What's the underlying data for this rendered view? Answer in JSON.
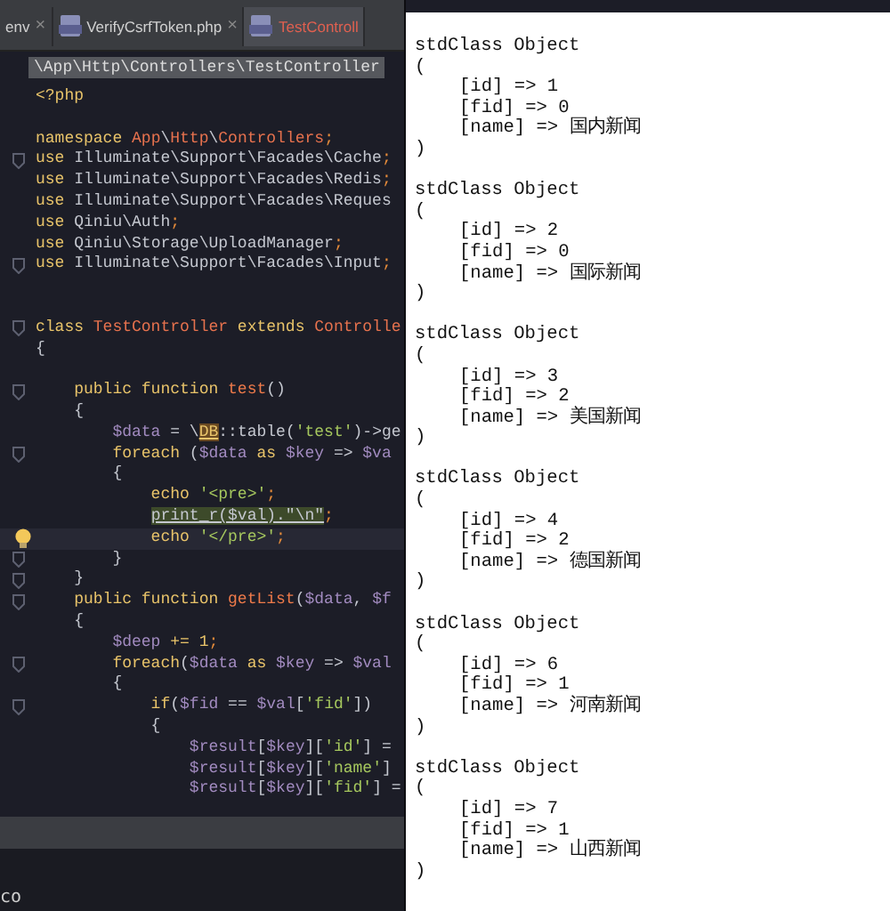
{
  "editor": {
    "tabs": [
      {
        "label": "env",
        "close": "×",
        "selected": false
      },
      {
        "label": "VerifyCsrfToken.php",
        "close": "×",
        "selected": false
      },
      {
        "label": "TestControll",
        "selected": true
      }
    ],
    "breadcrumb": "\\App\\Http\\Controllers\\TestController",
    "lines": [
      {
        "fold": false,
        "current": false,
        "segs": [
          {
            "kind": "kw",
            "text": "<?php"
          }
        ]
      },
      {
        "fold": false,
        "current": false
      },
      {
        "fold": false,
        "current": false,
        "segs": [
          {
            "kind": "kw",
            "text": "namespace "
          },
          {
            "kind": "cls",
            "text": "App"
          },
          {
            "kind": "plain",
            "text": "\\"
          },
          {
            "kind": "cls",
            "text": "Http"
          },
          {
            "kind": "plain",
            "text": "\\"
          },
          {
            "kind": "cls",
            "text": "Controllers"
          },
          {
            "kind": "punct",
            "text": ";"
          }
        ]
      },
      {
        "fold": true,
        "current": false,
        "segs": [
          {
            "kind": "kw",
            "text": "use "
          },
          {
            "kind": "plain",
            "text": "Illuminate\\Support\\Facades\\Cache"
          },
          {
            "kind": "punct",
            "text": ";"
          }
        ]
      },
      {
        "fold": false,
        "current": false,
        "segs": [
          {
            "kind": "kw",
            "text": "use "
          },
          {
            "kind": "plain",
            "text": "Illuminate\\Support\\Facades\\Redis"
          },
          {
            "kind": "punct",
            "text": ";"
          }
        ]
      },
      {
        "fold": false,
        "current": false,
        "segs": [
          {
            "kind": "kw",
            "text": "use "
          },
          {
            "kind": "plain",
            "text": "Illuminate\\Support\\Facades\\Reques"
          }
        ]
      },
      {
        "fold": false,
        "current": false,
        "segs": [
          {
            "kind": "kw",
            "text": "use "
          },
          {
            "kind": "plain",
            "text": "Qiniu\\Auth"
          },
          {
            "kind": "punct",
            "text": ";"
          }
        ]
      },
      {
        "fold": false,
        "current": false,
        "segs": [
          {
            "kind": "kw",
            "text": "use "
          },
          {
            "kind": "plain",
            "text": "Qiniu\\Storage\\UploadManager"
          },
          {
            "kind": "punct",
            "text": ";"
          }
        ]
      },
      {
        "fold": true,
        "current": false,
        "segs": [
          {
            "kind": "kw",
            "text": "use "
          },
          {
            "kind": "plain",
            "text": "Illuminate\\Support\\Facades\\Input"
          },
          {
            "kind": "punct",
            "text": ";"
          }
        ]
      },
      {
        "fold": false,
        "current": false
      },
      {
        "fold": false,
        "current": false
      },
      {
        "fold": true,
        "current": false,
        "segs": [
          {
            "kind": "kw",
            "text": "class "
          },
          {
            "kind": "cls",
            "text": "TestController "
          },
          {
            "kind": "kw",
            "text": "extends "
          },
          {
            "kind": "cls",
            "text": "Controlle"
          }
        ]
      },
      {
        "fold": false,
        "current": false,
        "segs": [
          {
            "kind": "plain",
            "text": "{"
          }
        ]
      },
      {
        "fold": false,
        "current": false
      },
      {
        "fold": true,
        "current": false,
        "segs": [
          {
            "kind": "kw",
            "text": "    public function "
          },
          {
            "kind": "fn",
            "text": "test"
          },
          {
            "kind": "plain",
            "text": "()"
          }
        ]
      },
      {
        "fold": false,
        "current": false,
        "segs": [
          {
            "kind": "plain",
            "text": "    {"
          }
        ]
      },
      {
        "fold": false,
        "current": false,
        "segs": [
          {
            "kind": "var",
            "text": "        $data"
          },
          {
            "kind": "plain",
            "text": " = \\"
          },
          {
            "kind": "ref",
            "text": "DB"
          },
          {
            "kind": "plain",
            "text": "::table("
          },
          {
            "kind": "str",
            "text": "'test'"
          },
          {
            "kind": "plain",
            "text": ")->ge"
          }
        ]
      },
      {
        "fold": true,
        "current": false,
        "segs": [
          {
            "kind": "kw",
            "text": "        foreach "
          },
          {
            "kind": "plain",
            "text": "("
          },
          {
            "kind": "var",
            "text": "$data "
          },
          {
            "kind": "kw",
            "text": "as "
          },
          {
            "kind": "var",
            "text": "$key "
          },
          {
            "kind": "plain",
            "text": "=> "
          },
          {
            "kind": "var",
            "text": "$va"
          }
        ]
      },
      {
        "fold": false,
        "current": false,
        "segs": [
          {
            "kind": "plain",
            "text": "        {"
          }
        ]
      },
      {
        "fold": false,
        "current": false,
        "segs": [
          {
            "kind": "kw",
            "text": "            echo "
          },
          {
            "kind": "str",
            "text": "'<pre>'"
          },
          {
            "kind": "punct",
            "text": ";"
          }
        ]
      },
      {
        "fold": false,
        "current": false,
        "segs": [
          {
            "kind": "marked",
            "text": "            print_r($val).\"\\n\""
          },
          {
            "kind": "punct",
            "text": ";"
          }
        ]
      },
      {
        "fold": false,
        "current": true,
        "segs": [
          {
            "kind": "kw",
            "text": "            echo "
          },
          {
            "kind": "str",
            "text": "'</pre>'"
          },
          {
            "kind": "punct",
            "text": ";"
          }
        ]
      },
      {
        "fold": true,
        "current": false,
        "segs": [
          {
            "kind": "plain",
            "text": "        }"
          }
        ]
      },
      {
        "fold": true,
        "current": false,
        "segs": [
          {
            "kind": "plain",
            "text": "    }"
          }
        ]
      },
      {
        "fold": true,
        "current": false,
        "segs": [
          {
            "kind": "kw",
            "text": "    public function "
          },
          {
            "kind": "fn",
            "text": "getList"
          },
          {
            "kind": "plain",
            "text": "("
          },
          {
            "kind": "var",
            "text": "$data"
          },
          {
            "kind": "plain",
            "text": ", "
          },
          {
            "kind": "var",
            "text": "$f"
          }
        ]
      },
      {
        "fold": false,
        "current": false,
        "segs": [
          {
            "kind": "plain",
            "text": "    {"
          }
        ]
      },
      {
        "fold": false,
        "current": false,
        "segs": [
          {
            "kind": "var",
            "text": "        $deep "
          },
          {
            "kind": "kw",
            "text": "+= 1"
          },
          {
            "kind": "punct",
            "text": ";"
          }
        ]
      },
      {
        "fold": true,
        "current": false,
        "segs": [
          {
            "kind": "kw",
            "text": "        foreach"
          },
          {
            "kind": "plain",
            "text": "("
          },
          {
            "kind": "var",
            "text": "$data "
          },
          {
            "kind": "kw",
            "text": "as "
          },
          {
            "kind": "var",
            "text": "$key "
          },
          {
            "kind": "plain",
            "text": "=> "
          },
          {
            "kind": "var",
            "text": "$val"
          }
        ]
      },
      {
        "fold": false,
        "current": false,
        "segs": [
          {
            "kind": "plain",
            "text": "        {"
          }
        ]
      },
      {
        "fold": true,
        "current": false,
        "segs": [
          {
            "kind": "kw",
            "text": "            if"
          },
          {
            "kind": "plain",
            "text": "("
          },
          {
            "kind": "var",
            "text": "$fid "
          },
          {
            "kind": "plain",
            "text": "== "
          },
          {
            "kind": "var",
            "text": "$val"
          },
          {
            "kind": "plain",
            "text": "["
          },
          {
            "kind": "str",
            "text": "'fid'"
          },
          {
            "kind": "plain",
            "text": "])"
          }
        ]
      },
      {
        "fold": false,
        "current": false,
        "segs": [
          {
            "kind": "plain",
            "text": "            {"
          }
        ]
      },
      {
        "fold": false,
        "current": false,
        "segs": [
          {
            "kind": "var",
            "text": "                $result"
          },
          {
            "kind": "plain",
            "text": "["
          },
          {
            "kind": "var",
            "text": "$key"
          },
          {
            "kind": "plain",
            "text": "]["
          },
          {
            "kind": "str",
            "text": "'id'"
          },
          {
            "kind": "plain",
            "text": "] ="
          }
        ]
      },
      {
        "fold": false,
        "current": false,
        "segs": [
          {
            "kind": "var",
            "text": "                $result"
          },
          {
            "kind": "plain",
            "text": "["
          },
          {
            "kind": "var",
            "text": "$key"
          },
          {
            "kind": "plain",
            "text": "]["
          },
          {
            "kind": "str",
            "text": "'name'"
          },
          {
            "kind": "plain",
            "text": "]"
          }
        ]
      },
      {
        "fold": false,
        "current": false,
        "segs": [
          {
            "kind": "var",
            "text": "                $result"
          },
          {
            "kind": "plain",
            "text": "["
          },
          {
            "kind": "var",
            "text": "$key"
          },
          {
            "kind": "plain",
            "text": "]["
          },
          {
            "kind": "str",
            "text": "'fid'"
          },
          {
            "kind": "plain",
            "text": "] ="
          }
        ]
      }
    ],
    "terminal": "co"
  },
  "output": {
    "objects": [
      {
        "title": "stdClass Object",
        "open": "(",
        "fields": [
          "[id] => 1",
          "[fid] => 0",
          "[name] => 国内新闻"
        ],
        "close": ")"
      },
      {
        "title": "stdClass Object",
        "open": "(",
        "fields": [
          "[id] => 2",
          "[fid] => 0",
          "[name] => 国际新闻"
        ],
        "close": ")"
      },
      {
        "title": "stdClass Object",
        "open": "(",
        "fields": [
          "[id] => 3",
          "[fid] => 2",
          "[name] => 美国新闻"
        ],
        "close": ")"
      },
      {
        "title": "stdClass Object",
        "open": "(",
        "fields": [
          "[id] => 4",
          "[fid] => 2",
          "[name] => 德国新闻"
        ],
        "close": ")"
      },
      {
        "title": "stdClass Object",
        "open": "(",
        "fields": [
          "[id] => 6",
          "[fid] => 1",
          "[name] => 河南新闻"
        ],
        "close": ")"
      },
      {
        "title": "stdClass Object",
        "open": "(",
        "fields": [
          "[id] => 7",
          "[fid] => 1",
          "[name] => 山西新闻"
        ],
        "close": ")"
      }
    ]
  }
}
